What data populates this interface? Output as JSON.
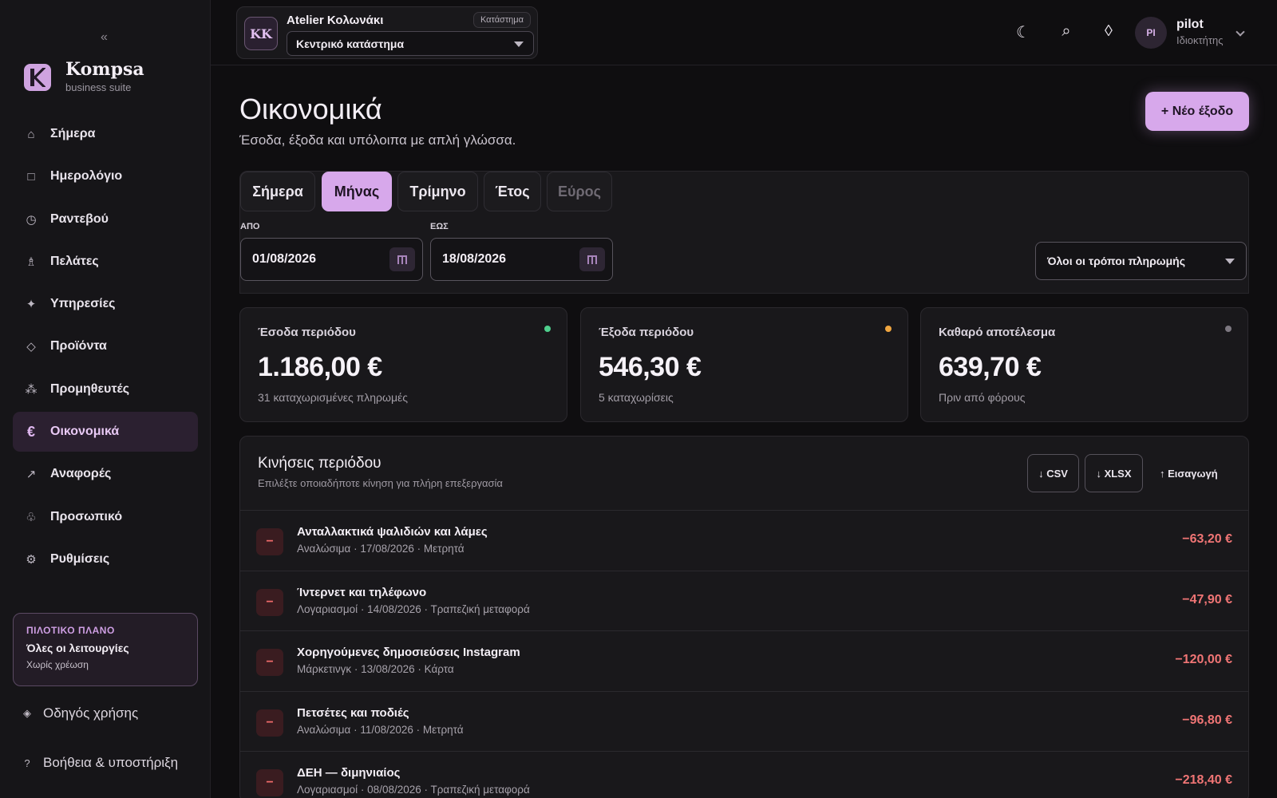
{
  "sidebar": {
    "collapse": "«",
    "brand": {
      "name": "Kompsa",
      "sub": "business suite",
      "icon": "kompsa-logo-icon"
    },
    "items": [
      {
        "label": "Σήμερα",
        "icon": "home-icon",
        "glyph": "⌂"
      },
      {
        "label": "Ημερολόγιο",
        "icon": "calendar-icon",
        "glyph": "□"
      },
      {
        "label": "Ραντεβού",
        "icon": "clock-icon",
        "glyph": "◷"
      },
      {
        "label": "Πελάτες",
        "icon": "person-icon",
        "glyph": "♗"
      },
      {
        "label": "Υπηρεσίες",
        "icon": "sparkle-icon",
        "glyph": "✦"
      },
      {
        "label": "Προϊόντα",
        "icon": "diamond-icon",
        "glyph": "◇"
      },
      {
        "label": "Προμηθευτές",
        "icon": "network-icon",
        "glyph": "⁂"
      },
      {
        "label": "Οικονομικά",
        "icon": "euro-icon",
        "glyph": "€",
        "active": true
      },
      {
        "label": "Αναφορές",
        "icon": "arrow-up-right-icon",
        "glyph": "↗"
      },
      {
        "label": "Προσωπικό",
        "icon": "staff-icon",
        "glyph": "♧"
      },
      {
        "label": "Ρυθμίσεις",
        "icon": "gear-icon",
        "glyph": "⚙"
      }
    ],
    "plan": {
      "tag": "ΠΙΛΟΤΙΚΟ ΠΛΑΝΟ",
      "title": "Όλες οι λειτουργίες",
      "sub": "Χωρίς χρέωση"
    },
    "guide": {
      "label": "Οδηγός χρήσης",
      "glyph": "◈"
    },
    "help": {
      "label": "Βοήθεια & υποστήριξη",
      "glyph": "?"
    }
  },
  "topbar": {
    "store": {
      "initials": "KK",
      "name": "Atelier Κολωνάκι",
      "tag": "Κατάστημα",
      "selected": "Κεντρικό κατάστημα"
    },
    "icons": {
      "theme": "☾",
      "search": "⌕",
      "diamond": "◊"
    },
    "user": {
      "initials": "PI",
      "name": "pilot",
      "role": "Ιδιοκτήτης"
    }
  },
  "page": {
    "title": "Οικονομικά",
    "subtitle": "Έσοδα, έξοδα και υπόλοιπα με απλή γλώσσα.",
    "new_button": "+ Νέο έξοδο"
  },
  "filters": {
    "tabs": [
      "Σήμερα",
      "Μήνας",
      "Τρίμηνο",
      "Έτος",
      "Εύρος"
    ],
    "active_tab": "Μήνας",
    "disabled_tab": "Εύρος",
    "from_label": "ΑΠΟ",
    "from_value": "01/08/2026",
    "to_label": "ΕΩΣ",
    "to_value": "18/08/2026",
    "payment_method": "Όλοι οι τρόποι πληρωμής"
  },
  "cards": [
    {
      "label": "Έσοδα περιόδου",
      "value": "1.186,00 €",
      "sub": "31 καταχωρισμένες πληρωμές",
      "dot": "#4fcf8d"
    },
    {
      "label": "Έξοδα περιόδου",
      "value": "546,30 €",
      "sub": "5 καταχωρίσεις",
      "dot": "#f0a640"
    },
    {
      "label": "Καθαρό αποτέλεσμα",
      "value": "639,70 €",
      "sub": "Πριν από φόρους",
      "dot": "#7d7881"
    }
  ],
  "movements": {
    "title": "Κινήσεις περιόδου",
    "subtitle": "Επιλέξτε οποιαδήποτε κίνηση για πλήρη επεξεργασία",
    "csv": "↓ CSV",
    "xlsx": "↓ XLSX",
    "import": "↑ Εισαγωγή",
    "rows": [
      {
        "title": "Ανταλλακτικά ψαλιδιών και λάμες",
        "meta": "Αναλώσιμα · 17/08/2026 · Μετρητά",
        "amount": "−63,20 €"
      },
      {
        "title": "Ίντερνετ και τηλέφωνο",
        "meta": "Λογαριασμοί · 14/08/2026 · Τραπεζική μεταφορά",
        "amount": "−47,90 €"
      },
      {
        "title": "Χορηγούμενες δημοσιεύσεις Instagram",
        "meta": "Μάρκετινγκ · 13/08/2026 · Κάρτα",
        "amount": "−120,00 €"
      },
      {
        "title": "Πετσέτες και ποδιές",
        "meta": "Αναλώσιμα · 11/08/2026 · Μετρητά",
        "amount": "−96,80 €"
      },
      {
        "title": "ΔΕΗ — διμηνιαίος",
        "meta": "Λογαριασμοί · 08/08/2026 · Τραπεζική μεταφορά",
        "amount": "−218,40 €"
      }
    ]
  }
}
